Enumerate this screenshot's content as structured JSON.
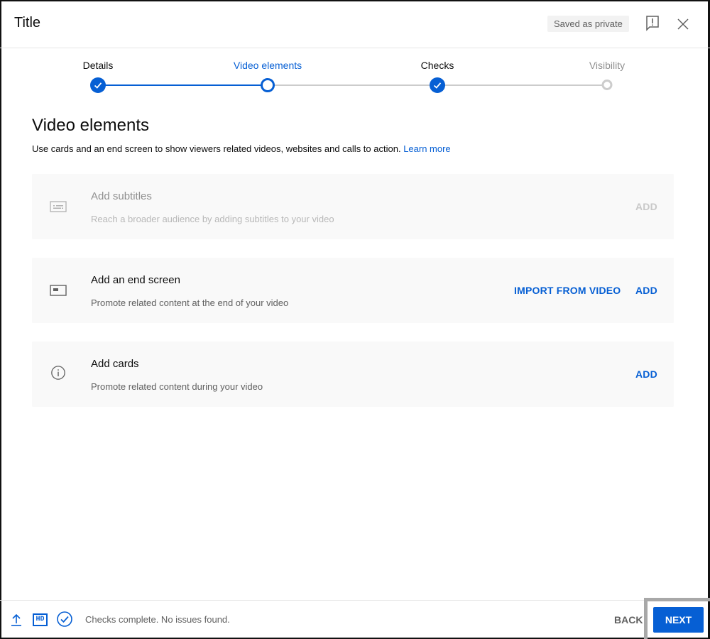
{
  "header": {
    "title": "Title",
    "saved_status": "Saved as private",
    "icons": [
      "feedback-icon",
      "close-icon"
    ]
  },
  "stepper": {
    "steps": [
      {
        "label": "Details",
        "state": "done"
      },
      {
        "label": "Video elements",
        "state": "active"
      },
      {
        "label": "Checks",
        "state": "done"
      },
      {
        "label": "Visibility",
        "state": "todo"
      }
    ]
  },
  "main": {
    "title": "Video elements",
    "description": "Use cards and an end screen to show viewers related videos, websites and calls to action.",
    "learn_more": "Learn more",
    "cards": [
      {
        "icon": "subtitles-icon",
        "title": "Add subtitles",
        "description": "Reach a broader audience by adding subtitles to your video",
        "disabled": true,
        "actions": [
          "ADD"
        ]
      },
      {
        "icon": "end-screen-icon",
        "title": "Add an end screen",
        "description": "Promote related content at the end of your video",
        "disabled": false,
        "actions": [
          "IMPORT FROM VIDEO",
          "ADD"
        ]
      },
      {
        "icon": "info-icon",
        "title": "Add cards",
        "description": "Promote related content during your video",
        "disabled": false,
        "actions": [
          "ADD"
        ]
      }
    ]
  },
  "footer": {
    "hd_label": "HD",
    "status": "Checks complete. No issues found.",
    "back_label": "BACK",
    "next_label": "NEXT"
  },
  "colors": {
    "accent": "#065fd4",
    "disabled_text": "#909090",
    "card_bg": "#f9f9f9"
  }
}
